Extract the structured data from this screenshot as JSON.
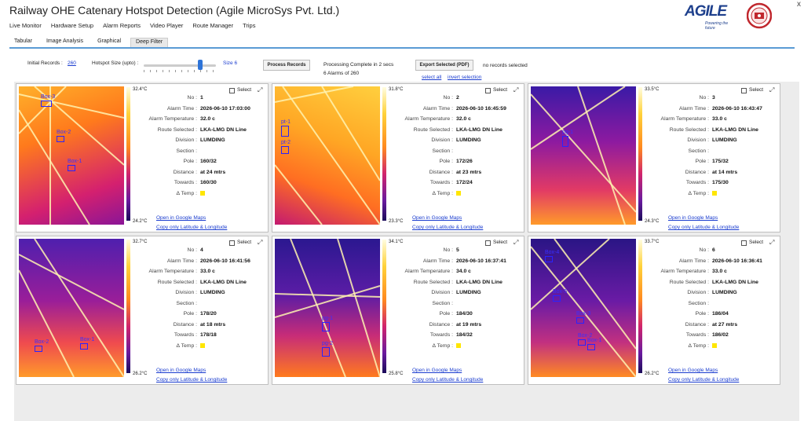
{
  "window": {
    "title": "Railway OHE Catenary Hotspot Detection (Agile MicroSys Pvt. Ltd.)",
    "close_glyph": "x",
    "logo_text": "AGILE",
    "logo_tagline": "Powering the future"
  },
  "menu": [
    "Live Monitor",
    "Hardware Setup",
    "Alarm Reports",
    "Video Player",
    "Route Manager",
    "Trips"
  ],
  "subtabs": [
    "Tabular",
    "Image Analysis",
    "Graphical",
    "Deep Filter"
  ],
  "active_subtab": "Deep Filter",
  "filter": {
    "initial_records_label": "Initial Records :",
    "initial_records_value": "260",
    "hotspot_label": "Hotspot Size (upto) :",
    "hotspot_size_text": "Size 6",
    "hotspot_slider_level": 0.78,
    "process_button": "Process Records",
    "status_line1": "Processing Complete in 2 secs",
    "status_line2": "6 Alarms of 260",
    "export_button": "Export Selected (PDF)",
    "selection_status": "no records selected",
    "select_all": "select all",
    "invert_selection": "invert selection"
  },
  "labels": {
    "no": "No :",
    "alarm_time": "Alarm Time :",
    "alarm_temperature": "Alarm Temperature :",
    "route_selected": "Route Selected :",
    "division": "Division :",
    "section": "Section :",
    "pole": "Pole :",
    "distance": "Distance :",
    "towards": "Towards :",
    "delta_temp": "Δ Temp :",
    "select": "Select",
    "open_maps": "Open in Google Maps",
    "copy_latlon": "Copy only Latitude & Longitude"
  },
  "cards": [
    {
      "no": "1",
      "alarm_time": "2026-06-10 17:03:00",
      "alarm_temperature": "32.0 c",
      "route": "LKA-LMG DN Line",
      "division": "LUMDING",
      "section": "",
      "pole": "160/32",
      "distance": "at 24 mtrs",
      "towards": "160/30",
      "scale_max": "32.4°C",
      "scale_min": "24.2°C",
      "boxes": [
        "Box-3",
        "Box-2",
        "Box-1"
      ]
    },
    {
      "no": "2",
      "alarm_time": "2026-06-10 16:45:59",
      "alarm_temperature": "32.0 c",
      "route": "LKA-LMG DN Line",
      "division": "LUMDING",
      "section": "",
      "pole": "172/26",
      "distance": "at 23 mtrs",
      "towards": "172/24",
      "scale_max": "31.8°C",
      "scale_min": "23.3°C",
      "boxes": [
        "pt-1",
        "pt-2"
      ]
    },
    {
      "no": "3",
      "alarm_time": "2026-06-10 16:43:47",
      "alarm_temperature": "33.0 c",
      "route": "LKA-LMG DN Line",
      "division": "LUMDING",
      "section": "",
      "pole": "175/32",
      "distance": "at 14 mtrs",
      "towards": "175/30",
      "scale_max": "33.5°C",
      "scale_min": "24.3°C",
      "boxes": [
        "pg-1"
      ]
    },
    {
      "no": "4",
      "alarm_time": "2026-06-10 16:41:56",
      "alarm_temperature": "33.0 c",
      "route": "LKA-LMG DN Line",
      "division": "LUMDING",
      "section": "",
      "pole": "178/20",
      "distance": "at 18 mtrs",
      "towards": "178/18",
      "scale_max": "32.7°C",
      "scale_min": "26.2°C",
      "boxes": [
        "Box-2",
        "Box-1"
      ]
    },
    {
      "no": "5",
      "alarm_time": "2026-06-10 16:37:41",
      "alarm_temperature": "34.0 c",
      "route": "LKA-LMG DN Line",
      "division": "LUMDING",
      "section": "",
      "pole": "184/30",
      "distance": "at 19 mtrs",
      "towards": "184/32",
      "scale_max": "34.1°C",
      "scale_min": "25.8°C",
      "boxes": [
        "pg-1",
        "pg-2"
      ]
    },
    {
      "no": "6",
      "alarm_time": "2026-06-10 16:36:41",
      "alarm_temperature": "33.0 c",
      "route": "LKA-LMG DN Line",
      "division": "LUMDING",
      "section": "",
      "pole": "186/04",
      "distance": "at 27 mtrs",
      "towards": "186/02",
      "scale_max": "33.7°C",
      "scale_min": "26.2°C",
      "boxes": [
        "Box-4",
        "Box-5",
        "Box-3",
        "Box-2",
        "Box-1"
      ]
    }
  ],
  "colors": {
    "accent_tab_underline": "#5a9bd5",
    "link": "#1a3ccf",
    "delta_chip": "#ffe600",
    "box_outline": "#2a23ff"
  }
}
